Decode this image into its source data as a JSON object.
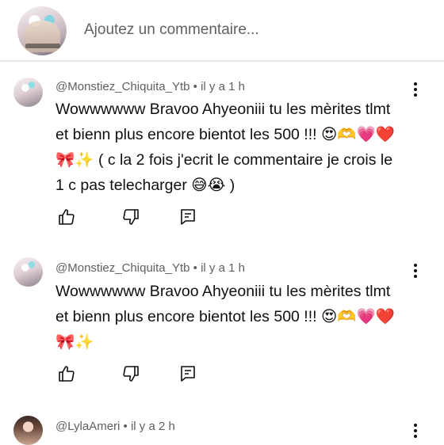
{
  "add_comment": {
    "placeholder": "Ajoutez un commentaire..."
  },
  "comments": [
    {
      "author": "@Monstiez_Chiquita_Ytb",
      "time": "il y a 1 h",
      "lines": [
        "Wowwwwww Bravoo Ahyeoniii tu les mèrites tlmt",
        "et bienn plus encore bientot les 500 !!! 😍🫶💗❤️",
        "🎀✨ ( c la 2 fois j'ecrit le commentaire je crois le",
        "1 c pas telecharger 😅😭 )"
      ]
    },
    {
      "author": "@Monstiez_Chiquita_Ytb",
      "time": "il y a 1 h",
      "lines": [
        "Wowwwwww Bravoo Ahyeoniii tu les mèrites tlmt",
        "et bienn plus encore bientot les 500 !!! 😍🫶💗❤️",
        "🎀✨"
      ]
    },
    {
      "author": "@LylaAmeri",
      "time": "il y a 2 h",
      "lines": []
    }
  ],
  "icons": {
    "like": "thumb-up-icon",
    "dislike": "thumb-down-icon",
    "reply": "reply-comment-icon",
    "menu": "more-vert-icon"
  }
}
